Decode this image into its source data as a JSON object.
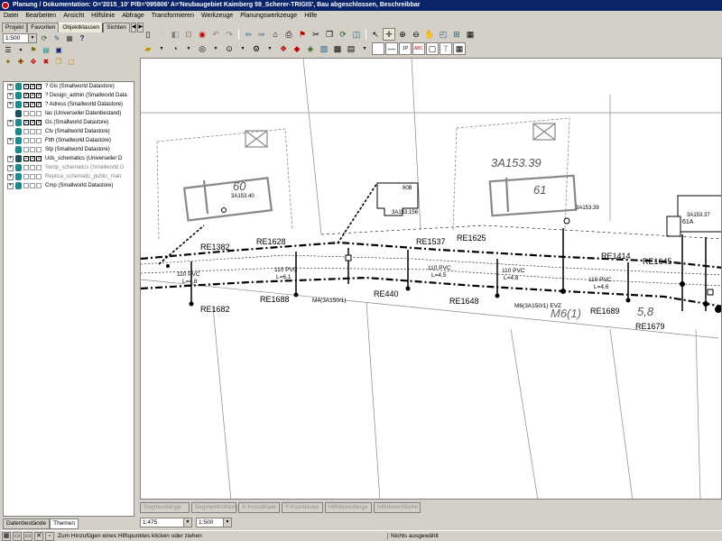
{
  "window": {
    "title": "Planung / Dokumentation: O='2015_10' P/B='095806' A='Neubaugebiet Kaimberg 59_Scherer-TRIGIS', Bau abgeschlossen, Beschreibbar"
  },
  "menu": [
    "Datei",
    "Bearbeiten",
    "Ansicht",
    "Hilfslinie",
    "Abfrage",
    "Transformieren",
    "Werkzeuge",
    "Planungswerkzeuge",
    "Hilfe"
  ],
  "panel": {
    "tabs": [
      "Projekt",
      "Favoriten",
      "Objektklassen",
      "Sichten"
    ],
    "active_tab": "Objektklassen",
    "scale_combo": "1:500",
    "tree": [
      {
        "label": "? Gis (Smallworld Datastore)",
        "expander": "+",
        "checks": [
          true,
          true,
          true
        ],
        "icon": "db",
        "dim": false
      },
      {
        "label": "? Design_admin (Smallworld Data",
        "expander": "+",
        "checks": [
          true,
          true,
          true
        ],
        "icon": "db",
        "dim": false
      },
      {
        "label": "? Adress (Smallworld Datastore)",
        "expander": "+",
        "checks": [
          true,
          true,
          true
        ],
        "icon": "db",
        "dim": false
      },
      {
        "label": "Ias (Universeller Datenbestand)",
        "expander": "",
        "checks": [
          false,
          false,
          false
        ],
        "icon": "db-dark",
        "dim": false
      },
      {
        "label": "Gs (Smallworld Datastore)",
        "expander": "+",
        "checks": [
          true,
          true,
          true
        ],
        "icon": "db",
        "dim": false
      },
      {
        "label": "Ctv (Smallworld Datastore)",
        "expander": "",
        "checks": [
          false,
          false,
          false
        ],
        "icon": "db",
        "dim": false
      },
      {
        "label": "Ftth (Smallworld Datastore)",
        "expander": "+",
        "checks": [
          false,
          false,
          false
        ],
        "icon": "db",
        "dim": false
      },
      {
        "label": "Stp (Smallworld Datastore)",
        "expander": "",
        "checks": [
          false,
          false,
          false
        ],
        "icon": "db",
        "dim": false
      },
      {
        "label": "Uds_schematics (Universeller D",
        "expander": "+",
        "checks": [
          true,
          true,
          true
        ],
        "icon": "db-dark",
        "dim": false
      },
      {
        "label": "Swdp_schematics (Smallworld D",
        "expander": "+",
        "checks": [
          false,
          false,
          false
        ],
        "icon": "db",
        "dim": true
      },
      {
        "label": "Replica_schematic_public_man",
        "expander": "+",
        "checks": [
          false,
          false,
          false
        ],
        "icon": "db",
        "dim": true
      },
      {
        "label": "Cmp (Smallworld Datastore)",
        "expander": "+",
        "checks": [
          false,
          false,
          false
        ],
        "icon": "db",
        "dim": false
      }
    ],
    "bottom_tabs": [
      "Datenbestände",
      "Themen"
    ]
  },
  "fields": [
    "Segmentlänge",
    "Segmentrichtung",
    "X-Koordinate",
    "Y-Koordinate",
    "Hilfslinienlänge",
    "Hilfslinienfläche"
  ],
  "scale": {
    "left": "1:475",
    "right": "1:500"
  },
  "status": {
    "message": "Zum Hinzufügen eines Hilfspunktes klicken oder ziehen",
    "selection": "Nichts ausgewählt"
  },
  "map": {
    "parcels": [
      "60",
      "3A153.39",
      "61",
      "61A"
    ],
    "buildings": [
      "3A153.40",
      "60B",
      "3A153.156",
      "3A153.39",
      "3A153.37"
    ],
    "routes": [
      "RE1382",
      "RE1628",
      "RE1537",
      "RE1625",
      "RE1414",
      "RE1645",
      "RE1688",
      "RE440",
      "RE1648",
      "RE1689",
      "RE1682",
      "RE1679"
    ],
    "cables": [
      "110 PVC",
      "L=4,8",
      "110 PVC",
      "L=6,1",
      "110 PVC",
      "L=4,5",
      "110 PVC",
      "L=4,8",
      "110 PVC",
      "L=4,6"
    ],
    "manholes": [
      "M4(3A150/1)",
      "M6(3A150/1) EVZ"
    ],
    "handwritten": [
      "M6(1)",
      "5,8"
    ]
  },
  "colors": {
    "titlebar": "#0a246a",
    "chrome": "#d4d0c8",
    "map_bg": "#ffffff",
    "parcel": "#888888",
    "cable": "#000000"
  }
}
